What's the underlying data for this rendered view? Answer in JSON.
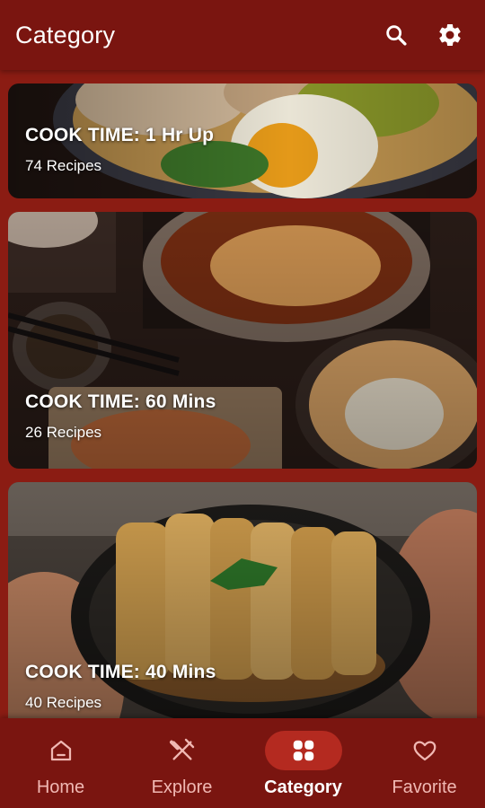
{
  "appbar": {
    "title": "Category",
    "icons": [
      "search-icon",
      "gear-icon"
    ]
  },
  "categories": [
    {
      "title": "COOK TIME: 1 Hr Up",
      "count": "74 Recipes"
    },
    {
      "title": "COOK TIME: 60 Mins",
      "count": "26 Recipes"
    },
    {
      "title": "COOK TIME: 40 Mins",
      "count": "40 Recipes"
    }
  ],
  "nav": {
    "items": [
      {
        "label": "Home",
        "icon": "home-icon"
      },
      {
        "label": "Explore",
        "icon": "fork-knife-icon"
      },
      {
        "label": "Category",
        "icon": "grid-icon",
        "active": true
      },
      {
        "label": "Favorite",
        "icon": "heart-icon"
      }
    ]
  },
  "colors": {
    "appbar": "#7a1510",
    "background": "#8b1c13",
    "active_pill": "#b42a20",
    "inactive_label": "#f0b8b3"
  }
}
